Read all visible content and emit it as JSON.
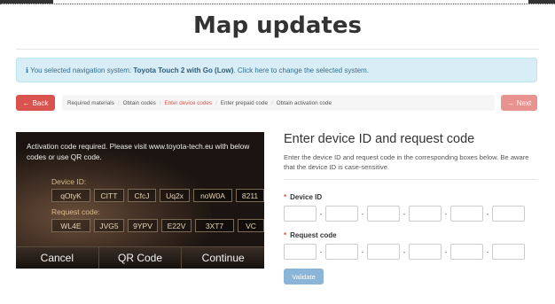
{
  "page": {
    "title": "Map updates"
  },
  "info": {
    "prefix": "You selected navigation system:",
    "system": "Toyota Touch 2 with Go (Low)",
    "suffix": ". Click here to change the selected system."
  },
  "nav": {
    "back_label": "Back",
    "next_label": "Next",
    "steps": [
      {
        "label": "Required materials",
        "active": false
      },
      {
        "label": "Obtain codes",
        "active": false
      },
      {
        "label": "Enter device codes",
        "active": true
      },
      {
        "label": "Enter prepaid code",
        "active": false
      },
      {
        "label": "Obtain activation code",
        "active": false
      }
    ]
  },
  "device_screen": {
    "message": "Activation code required. Please visit www.toyota-tech.eu with below codes or use QR code.",
    "device_id_label": "Device ID:",
    "device_id_codes": [
      "qOtyK",
      "CITT",
      "CfcJ",
      "Uq2x",
      "noW0A",
      "8211"
    ],
    "request_code_label": "Request code:",
    "request_codes": [
      "WL4E",
      "JVG5",
      "9YPV",
      "E22V",
      "3XT7",
      "VC"
    ],
    "buttons": {
      "cancel": "Cancel",
      "qr": "QR Code",
      "continue": "Continue"
    }
  },
  "form": {
    "heading": "Enter device ID and request code",
    "description": "Enter the device ID and request code in the corresponding boxes below. Be aware that the device ID is case-sensitive.",
    "device_id_label": "Device ID",
    "request_code_label": "Request code",
    "required_marker": "*",
    "separator": "-",
    "validate_label": "Validate"
  },
  "colors": {
    "danger": "#d9534f",
    "danger_light": "#e8938f",
    "info_bg": "#d9edf7",
    "validate": "#8ab4d8"
  }
}
